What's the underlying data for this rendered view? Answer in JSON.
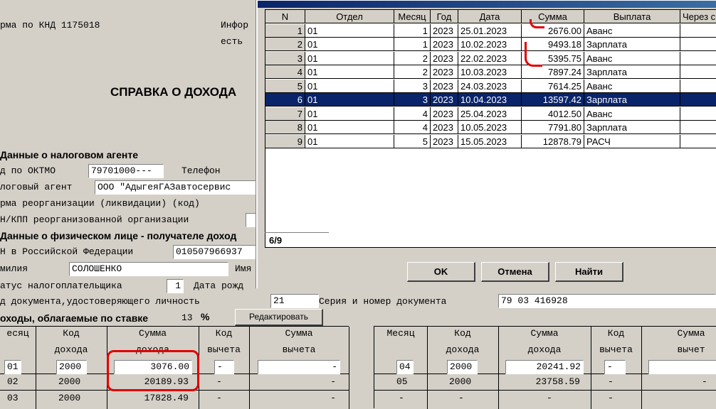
{
  "form": {
    "knd_text": "рма по КНД 1175018",
    "info_text": "Инфор",
    "est_text": "есть",
    "title": "СПРАВКА О ДОХОДА",
    "agent_section": "Данные о налоговом агенте",
    "oktmo_label": "д по ОКТМО",
    "oktmo_value": "79701000---",
    "phone_label": "Телефон",
    "agent_label": "логовый агент",
    "agent_value": "ООО \"АдыгеяГАЗавтосервис",
    "reorg_label": "рма реорганизации (ликвидации) (код)",
    "inn_kpp_label": "Н/КПП реорганизованной организации",
    "person_section": "Данные о физическом лице - получателе доход",
    "inn_label": "Н в Российской Федерации",
    "inn_value": "010507966937",
    "surname_label": "милия",
    "surname_value": "СОЛОШЕНКО",
    "name_label": "Имя",
    "status_label": "атус налогоплательщика",
    "status_value": "1",
    "birth_label": "Дата рожд",
    "doc_code_label": "д документа,удостоверяющего личность",
    "doc_code_value": "21",
    "doc_series_label": "Серия и номер документа",
    "doc_series_value": "79 03 416928",
    "income_label": "оходы, облагаемые по ставке",
    "rate_value": "13",
    "percent": "%",
    "edit_button": "Редактировать"
  },
  "income_table": {
    "headers": {
      "month": "есяц",
      "code_line1": "Код",
      "code_line2": "дохода",
      "sum_line1": "Сумма",
      "sum_line2": "дохода",
      "ded_line1": "Код",
      "ded_line2": "вычета",
      "dsum_line1": "Сумма",
      "dsum_line2": "вычета",
      "month_r": "Месяц",
      "code_r1": "Код",
      "code_r2": "дохода",
      "sum_r1": "Сумма",
      "sum_r2": "дохода",
      "ded_r1": "Код",
      "ded_r2": "вычета",
      "dsum_r1": "Сумма",
      "dsum_r2": "вычет"
    },
    "left_rows": [
      {
        "month": "01",
        "code": "2000",
        "sum": "3076.00",
        "ded": "-",
        "dsum": "-"
      },
      {
        "month": "02",
        "code": "2000",
        "sum": "20189.93",
        "ded": "-",
        "dsum": "-"
      },
      {
        "month": "03",
        "code": "2000",
        "sum": "17828.49",
        "ded": "-",
        "dsum": "-"
      }
    ],
    "right_rows": [
      {
        "month": "04",
        "code": "2000",
        "sum": "20241.92",
        "ded": "-",
        "dsum": ""
      },
      {
        "month": "05",
        "code": "2000",
        "sum": "23758.59",
        "ded": "-",
        "dsum": "-"
      },
      {
        "month": "-",
        "code": "-",
        "sum": "-",
        "ded": "-",
        "dsum": ""
      }
    ]
  },
  "dialog": {
    "columns": [
      "N",
      "Отдел",
      "Месяц",
      "Год",
      "Дата",
      "Сумма",
      "Выплата",
      "Через с"
    ],
    "rows": [
      {
        "n": "1",
        "dept": "01",
        "month": "1",
        "year": "2023",
        "date": "25.01.2023",
        "sum": "2676.00",
        "pay": "Аванс"
      },
      {
        "n": "2",
        "dept": "01",
        "month": "1",
        "year": "2023",
        "date": "10.02.2023",
        "sum": "9493.18",
        "pay": "Зарплата"
      },
      {
        "n": "3",
        "dept": "01",
        "month": "2",
        "year": "2023",
        "date": "22.02.2023",
        "sum": "5395.75",
        "pay": "Аванс"
      },
      {
        "n": "4",
        "dept": "01",
        "month": "2",
        "year": "2023",
        "date": "10.03.2023",
        "sum": "7897.24",
        "pay": "Зарплата"
      },
      {
        "n": "5",
        "dept": "01",
        "month": "3",
        "year": "2023",
        "date": "24.03.2023",
        "sum": "7614.25",
        "pay": "Аванс"
      },
      {
        "n": "6",
        "dept": "01",
        "month": "3",
        "year": "2023",
        "date": "10.04.2023",
        "sum": "13597.42",
        "pay": "Зарплата"
      },
      {
        "n": "7",
        "dept": "01",
        "month": "4",
        "year": "2023",
        "date": "25.04.2023",
        "sum": "4012.50",
        "pay": "Аванс"
      },
      {
        "n": "8",
        "dept": "01",
        "month": "4",
        "year": "2023",
        "date": "10.05.2023",
        "sum": "7791.80",
        "pay": "Зарплата"
      },
      {
        "n": "9",
        "dept": "01",
        "month": "5",
        "year": "2023",
        "date": "15.05.2023",
        "sum": "12878.79",
        "pay": "РАСЧ"
      }
    ],
    "selected_row": 6,
    "status": "6/9",
    "ok_button": "OK",
    "cancel_button": "Отмена",
    "find_button": "Найти"
  },
  "colors": {
    "window_bg": "#d4d0c8",
    "selection": "#0a246a",
    "annotation_red": "#e00000"
  }
}
